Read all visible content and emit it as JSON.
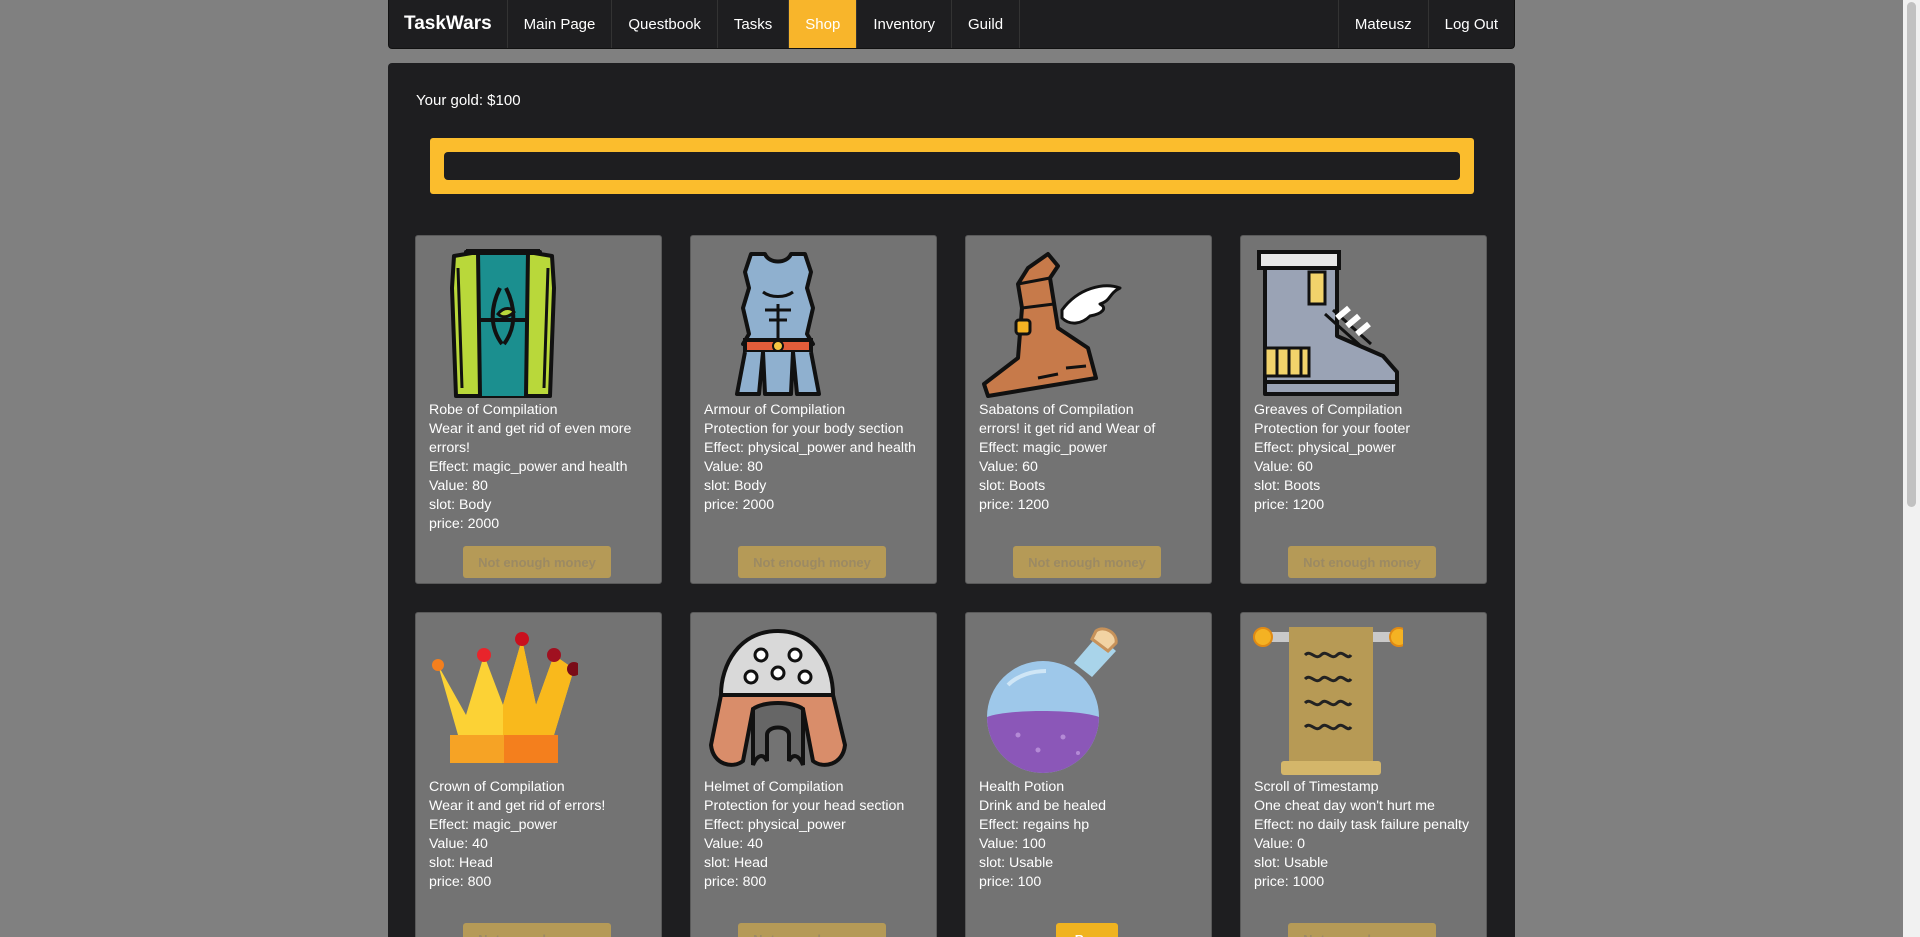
{
  "nav": {
    "brand": "TaskWars",
    "links": [
      "Main Page",
      "Questbook",
      "Tasks",
      "Shop",
      "Inventory",
      "Guild"
    ],
    "user": "Mateusz",
    "logout": "Log Out"
  },
  "shop": {
    "gold_label": "Your gold: $100",
    "search_placeholder": ""
  },
  "items": [
    {
      "name": "Robe of Compilation",
      "desc": "Wear it and get rid of even more errors!",
      "effect": "Effect: magic_power and health",
      "value": "Value: 80",
      "slot": "slot: Body",
      "price": "price: 2000",
      "button": "Not enough money",
      "affordable": false,
      "icon": "robe-icon"
    },
    {
      "name": "Armour of Compilation",
      "desc": "Protection for your body section",
      "effect": "Effect: physical_power and health",
      "value": "Value: 80",
      "slot": "slot: Body",
      "price": "price: 2000",
      "button": "Not enough money",
      "affordable": false,
      "icon": "armour-icon"
    },
    {
      "name": "Sabatons of Compilation",
      "desc": "errors! it get rid and Wear of",
      "effect": "Effect: magic_power",
      "value": "Value: 60",
      "slot": "slot: Boots",
      "price": "price: 1200",
      "button": "Not enough money",
      "affordable": false,
      "icon": "winged-boot-icon"
    },
    {
      "name": "Greaves of Compilation",
      "desc": "Protection for your footer",
      "effect": "Effect: physical_power",
      "value": "Value: 60",
      "slot": "slot: Boots",
      "price": "price: 1200",
      "button": "Not enough money",
      "affordable": false,
      "icon": "armored-boot-icon"
    },
    {
      "name": "Crown of Compilation",
      "desc": "Wear it and get rid of errors!",
      "effect": "Effect: magic_power",
      "value": "Value: 40",
      "slot": "slot: Head",
      "price": "price: 800",
      "button": "Not enough money",
      "affordable": false,
      "icon": "crown-icon"
    },
    {
      "name": "Helmet of Compilation",
      "desc": "Protection for your head section",
      "effect": "Effect: physical_power",
      "value": "Value: 40",
      "slot": "slot: Head",
      "price": "price: 800",
      "button": "Not enough money",
      "affordable": false,
      "icon": "helmet-icon"
    },
    {
      "name": "Health Potion",
      "desc": "Drink and be healed",
      "effect": "Effect: regains hp",
      "value": "Value: 100",
      "slot": "slot: Usable",
      "price": "price: 100",
      "button": "Buy",
      "affordable": true,
      "icon": "potion-icon"
    },
    {
      "name": "Scroll of Timestamp",
      "desc": "One cheat day won't hurt me",
      "effect": "Effect: no daily task failure penalty",
      "value": "Value: 0",
      "slot": "slot: Usable",
      "price": "price: 1000",
      "button": "Not enough money",
      "affordable": false,
      "icon": "scroll-icon"
    }
  ],
  "colors": {
    "accent": "#f8b52b",
    "panel": "#1e1e20",
    "card": "#737373",
    "page_bg": "#808080"
  }
}
